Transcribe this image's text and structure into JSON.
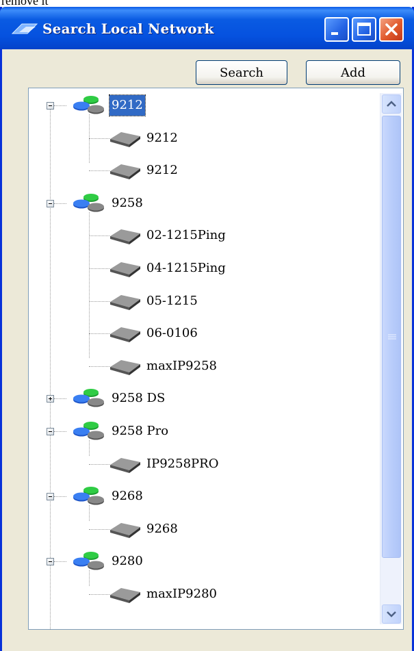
{
  "caption": "remove it",
  "window": {
    "title": "Search Local Network",
    "buttons": {
      "search": "Search",
      "add": "Add"
    },
    "title_icons": [
      "minimize-icon",
      "maximize-icon",
      "close-icon"
    ]
  },
  "tree": [
    {
      "label": "9212",
      "expanded": true,
      "selected": true,
      "children": [
        "9212",
        "9212"
      ]
    },
    {
      "label": "9258",
      "expanded": true,
      "children": [
        "02-1215Ping",
        "04-1215Ping",
        "05-1215",
        "06-0106",
        "maxIP9258"
      ]
    },
    {
      "label": "9258 DS",
      "expanded": false,
      "children": []
    },
    {
      "label": "9258 Pro",
      "expanded": true,
      "children": [
        "IP9258PRO"
      ]
    },
    {
      "label": "9268",
      "expanded": true,
      "children": [
        "9268"
      ]
    },
    {
      "label": "9280",
      "expanded": true,
      "children": [
        "maxIP9280"
      ]
    }
  ],
  "colors": {
    "titlebar": "#0a5be2",
    "selection": "#316ac5",
    "window_bg": "#ece9d8"
  }
}
